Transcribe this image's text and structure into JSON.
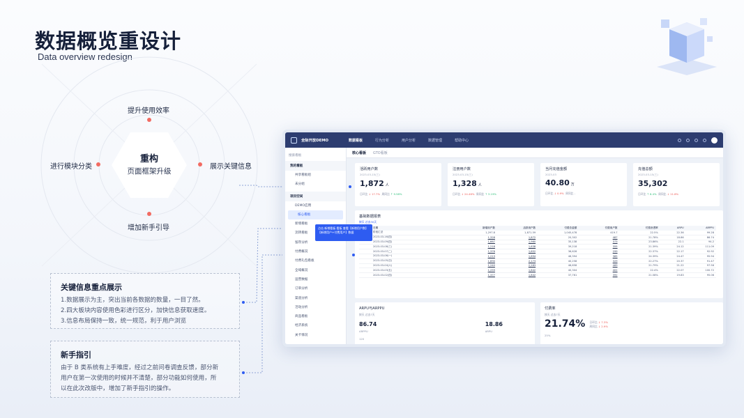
{
  "title": "数据概览重设计",
  "subtitle": "Data overview redesign",
  "hex": {
    "title": "重构",
    "sub": "页面框架升级"
  },
  "nodes": {
    "top": "提升使用效率",
    "left": "进行模块分类",
    "right": "展示关键信息",
    "bottom": "增加新手引导"
  },
  "cards": [
    {
      "title": "关键信息重点展示",
      "lines": [
        "1.数据展示为主，突出当前各数据的数量，一目了然。",
        "2.四大板块内容使用色彩进行区分，加快信息获取速度。",
        "3.信息布局保持一致，统一规范，利于用户浏览"
      ]
    },
    {
      "title": "新手指引",
      "lines": [
        "由于 B 类系统有上手难度，经过之前问卷调查反馈，部分新",
        "用户在第一次使用的时候并不清楚，部分功能如何使用，所",
        "以在此次改版中，增加了新手指引的操作。"
      ]
    }
  ],
  "dash": {
    "logo": "全际开放DEMO",
    "nav": [
      "数据看板",
      "行为分析",
      "用户分析",
      "数据管理",
      "帮助中心"
    ],
    "tabs": [
      "核心看板",
      "GTO看板"
    ],
    "search": "搜索看板",
    "sidebar": {
      "sec1": "我的看板",
      "items1": [
        "共享看板组",
        "未分组"
      ],
      "sec2": "项目空间",
      "items2": [
        "DEMO应用",
        "核心看板",
        "新增看板",
        "流转看板",
        "留存分析",
        "付费概况",
        "付费礼包看板",
        "全域概况",
        "运营数据",
        "订单分析",
        "渠道分析",
        "活动分析",
        "商品看板",
        "经济系统",
        "关卡情况"
      ]
    },
    "tooltip": "点击 新增看板 看板 查看【新增用户数】【新增用户+付费用户】数据",
    "kpis": [
      {
        "title": "活跃用户数",
        "date": "2023-03-15(三)",
        "value": "1,872",
        "unit": "人",
        "cmp": "日环比",
        "cmp_v": "↓ 17.7%",
        "cmp2": "周同比",
        "cmp2_v": "↑ 9.58%"
      },
      {
        "title": "注册用户数",
        "date": "2023-03-15(三)",
        "value": "1,328",
        "unit": "人",
        "cmp": "日环比",
        "cmp_v": "↓ 24.46%",
        "cmp2": "周同比",
        "cmp2_v": "↑ 3.19%"
      },
      {
        "title": "当月充值金额",
        "date": "2023-03",
        "value": "40.80",
        "unit": "万",
        "cmp": "日环比",
        "cmp_v": "↓ 0.9%",
        "cmp2": "周同比",
        "cmp2_v": "-"
      },
      {
        "title": "充值总额",
        "date": "2023-03-15(三)",
        "value": "35,302",
        "unit": "",
        "cmp": "日环比",
        "cmp_v": "↑ 8.4%",
        "cmp2": "周同比",
        "cmp2_v": "↓ 11.8%"
      }
    ],
    "table": {
      "title": "基础数据报表",
      "filter": "按天  过去30天",
      "headers": [
        "日期",
        "新增用户数",
        "活跃用户数",
        "付费总金额",
        "付费用户数",
        "付费渗透率",
        "ARPU",
        "ARPPU"
      ],
      "rows": [
        [
          "阶段汇总",
          "1,297.8",
          "1,871.59",
          "1,045,478",
          "419.7",
          "22.5%",
          "22.36",
          "99.28"
        ],
        [
          "2023-03-16(四)",
          "1,328",
          "1,872",
          "20,302",
          "487",
          "21.78%",
          "18.86",
          "86.74"
        ],
        [
          "2023-03-09(四)",
          "1,667",
          "1,960",
          "35,138",
          "373",
          "23.86%",
          "22.1",
          "94.2"
        ],
        [
          "2023-03-08(三)",
          "1,218",
          "1,638",
          "39,218",
          "355",
          "21.39%",
          "24.12",
          "111.09"
        ],
        [
          "2023-03-07(二)",
          "1,376",
          "1,652",
          "36,628",
          "299",
          "22.37%",
          "22.17",
          "92.92"
        ],
        [
          "2023-03-06(一)",
          "1,213",
          "1,694",
          "46,394",
          "365",
          "24.39%",
          "24.47",
          "95.94"
        ],
        [
          "2023-03-05(日)",
          "1,690",
          "2,173",
          "40,258",
          "329",
          "22.27%",
          "20.37",
          "91.47"
        ],
        [
          "2023-03-04(六)",
          "1,240",
          "2,283",
          "46,658",
          "469",
          "21.79%",
          "21.22",
          "97.56"
        ],
        [
          "2023-03-03(五)",
          "1,259",
          "1,842",
          "40,304",
          "402",
          "22.4%",
          "22.07",
          "100.72"
        ],
        [
          "2023-03-02(四)",
          "1,377",
          "1,842",
          "37,761",
          "392",
          "21.58%",
          "19.83",
          "95.06"
        ]
      ]
    },
    "arpu": {
      "title": "ARPU与ARPPU",
      "filter": "按天  过去7天",
      "v1": "86.74",
      "v1l": "ARPPU",
      "v2": "18.86",
      "v2l": "ARPU",
      "axis": "120"
    },
    "pay": {
      "title": "付费率",
      "filter": "按天  过去7天",
      "value": "21.74%",
      "c1": "日环比",
      "c1v": "↓ 7.3%",
      "c2": "周同比",
      "c2v": "↓ 2.9%",
      "axis": "25%"
    }
  }
}
